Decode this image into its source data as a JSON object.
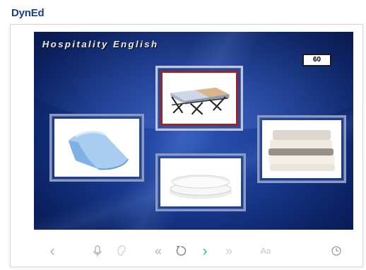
{
  "brand": {
    "logo_text": "DynEd",
    "logo_mark": "´"
  },
  "lesson": {
    "title": "Hospitality English",
    "timer": "60"
  },
  "cards": [
    {
      "name": "card-rollaway-bed",
      "icon": "rollaway-bed-image",
      "selected": true
    },
    {
      "name": "card-blanket",
      "icon": "blanket-image",
      "selected": false
    },
    {
      "name": "card-pillows",
      "icon": "pillows-image",
      "selected": false
    },
    {
      "name": "card-sheets",
      "icon": "folded-sheets-image",
      "selected": false
    }
  ],
  "controls": {
    "back": "‹",
    "rewind": "«",
    "next": "›",
    "fast_forward": "»",
    "text_toggle": "Aa"
  },
  "colors": {
    "brand": "#1a3f8f",
    "stage_dark": "#0b2060",
    "selected_border": "#9e2424",
    "next_active": "#2ec79b",
    "control_inactive": "#b4b4b4"
  }
}
